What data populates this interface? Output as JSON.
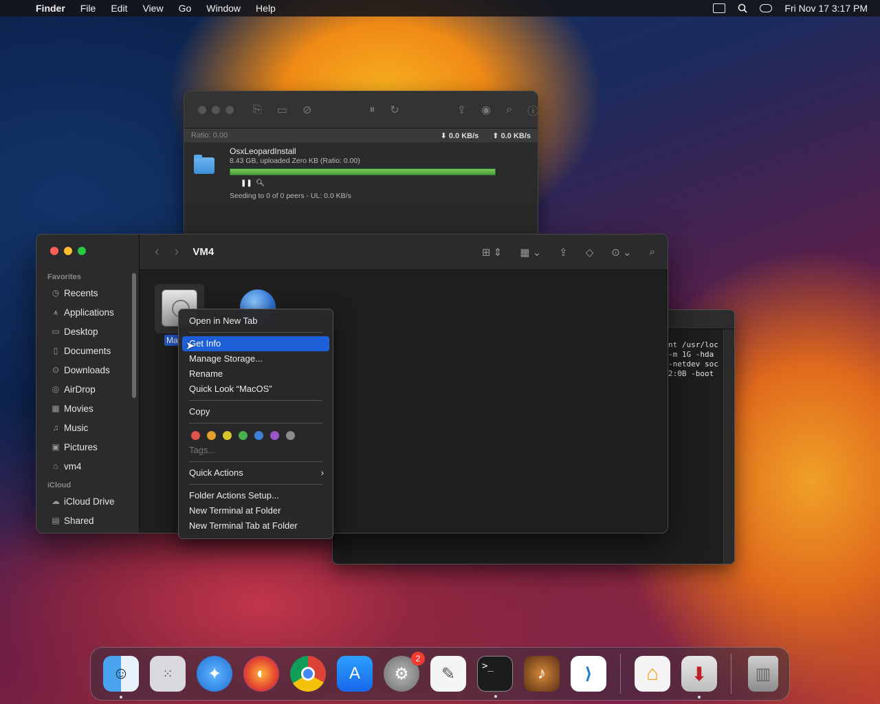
{
  "menubar": {
    "app_name": "Finder",
    "menus": [
      "File",
      "Edit",
      "View",
      "Go",
      "Window",
      "Help"
    ],
    "clock": "Fri Nov 17  3:17 PM"
  },
  "transmission": {
    "ratio": "Ratio: 0.00",
    "down_rate": "0.0 KB/s",
    "up_rate": "0.0 KB/s",
    "torrent": {
      "name": "OsxLeopardInstall",
      "size_info": "8.43 GB, uploaded Zero KB (Ratio: 0.00)",
      "status": "Seeding to 0 of 0 peers - UL: 0.0 KB/s",
      "progress": 1.0
    }
  },
  "terminal": {
    "lines": [
      "nt /usr/loc",
      "-m 1G -hda",
      "-netdev soc",
      "2:0B -boot"
    ]
  },
  "finder": {
    "title": "VM4",
    "sections": {
      "favorites": "Favorites",
      "icloud": "iCloud"
    },
    "sidebar": [
      {
        "label": "Recents",
        "icon": "clock-icon"
      },
      {
        "label": "Applications",
        "icon": "applications-icon"
      },
      {
        "label": "Desktop",
        "icon": "desktop-icon"
      },
      {
        "label": "Documents",
        "icon": "document-icon"
      },
      {
        "label": "Downloads",
        "icon": "downloads-icon"
      },
      {
        "label": "AirDrop",
        "icon": "airdrop-icon"
      },
      {
        "label": "Movies",
        "icon": "movies-icon"
      },
      {
        "label": "Music",
        "icon": "music-icon"
      },
      {
        "label": "Pictures",
        "icon": "pictures-icon"
      },
      {
        "label": "vm4",
        "icon": "home-icon"
      }
    ],
    "icloud_items": [
      {
        "label": "iCloud Drive",
        "icon": "cloud-icon"
      },
      {
        "label": "Shared",
        "icon": "shared-folder-icon"
      }
    ],
    "selected_item_label": "Mac"
  },
  "context_menu": {
    "items_top": [
      "Open in New Tab",
      "Get Info",
      "Manage Storage...",
      "Rename",
      "Quick Look “MacOS”"
    ],
    "copy": "Copy",
    "tag_colors": [
      "#e0534a",
      "#e2a12c",
      "#d6c62b",
      "#4ab34d",
      "#3b7fd6",
      "#9a56c8",
      "#8c8c8c"
    ],
    "tags_placeholder": "Tags...",
    "quick_actions": "Quick Actions",
    "items_bottom": [
      "Folder Actions Setup...",
      "New Terminal at Folder",
      "New Terminal Tab at Folder"
    ]
  },
  "dock": {
    "badge_count": "2"
  }
}
